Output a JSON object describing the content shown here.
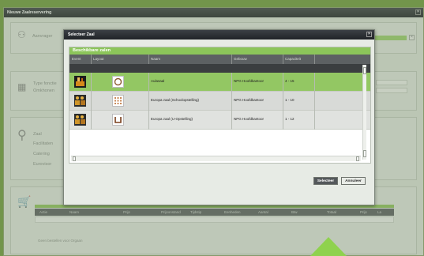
{
  "window": {
    "title": "Nieuwe Zaalreservering",
    "close_glyph": "×"
  },
  "background_form": {
    "section1_label": "Aanvrager",
    "section2_labels": [
      "Type fonctie",
      "Omkhonen"
    ],
    "section3_labels": [
      "Zaal",
      "Facilitaten",
      "Catering",
      "Eurovisor"
    ],
    "table_headers": [
      "Actie",
      "Naam",
      "Prijs",
      "Prijsonstand",
      "Tijdstip",
      "Eenheden",
      "Aantal",
      "Btw",
      "Totaal",
      "Prijs",
      "La Contains"
    ],
    "empty_message": "Geen bestellen voor Orgaan"
  },
  "dialog": {
    "title": "Selecteer Zaal",
    "close_glyph": "×",
    "available_header": "Beschikbare zalen",
    "columns": [
      "Event",
      "Layout",
      "Naam",
      "Gebouw",
      "Capaciteit"
    ],
    "rooms": [
      {
        "name": "Aulasaal",
        "building": "NPG Hoofdkantoor",
        "capacity": "4 - 15",
        "selected": true,
        "layout_icon": "round-table-icon",
        "event_icon": "event-stage-icon"
      },
      {
        "name": "Europa zaal (Schoolopstelling)",
        "building": "NPG Hoofdkantoor",
        "capacity": "1 - 10",
        "selected": false,
        "layout_icon": "classroom-layout-icon",
        "event_icon": "event-people-icon"
      },
      {
        "name": "Europa zaal (U-Opstelling)",
        "building": "NPG Hoofdkantoor",
        "capacity": "1 - 12",
        "selected": false,
        "layout_icon": "u-shape-layout-icon",
        "event_icon": "event-people-icon"
      }
    ],
    "buttons": {
      "select": "Selecteer",
      "cancel": "Annuleer"
    }
  },
  "colors": {
    "accent_green": "#8cc55a",
    "selected_row": "#93c763",
    "header_dark": "#5d6163"
  }
}
